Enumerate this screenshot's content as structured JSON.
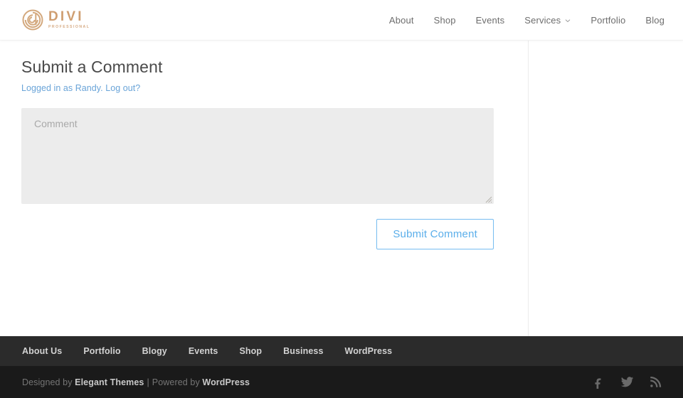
{
  "header": {
    "logo": {
      "name": "DIVI",
      "tagline": "PROFESSIONAL",
      "icon": "divi-spiral-logo-icon",
      "color": "#cf9e71"
    },
    "nav": [
      {
        "label": "About",
        "has_dropdown": false
      },
      {
        "label": "Shop",
        "has_dropdown": false
      },
      {
        "label": "Events",
        "has_dropdown": false
      },
      {
        "label": "Services",
        "has_dropdown": true,
        "caret_icon": "chevron-down-icon"
      },
      {
        "label": "Portfolio",
        "has_dropdown": false
      },
      {
        "label": "Blog",
        "has_dropdown": false
      }
    ]
  },
  "main": {
    "comment_form": {
      "title": "Submit a Comment",
      "logged_in_prefix": "Logged in as Randy.",
      "logout_label": "Log out?",
      "comment_placeholder": "Comment",
      "comment_value": "",
      "submit_label": "Submit Comment",
      "submit_color": "#5aaeea",
      "field_background": "#ececec",
      "resize_handle_icon": "resize-grip-icon"
    }
  },
  "footer": {
    "nav": [
      {
        "label": "About Us"
      },
      {
        "label": "Portfolio"
      },
      {
        "label": "Blogy"
      },
      {
        "label": "Events"
      },
      {
        "label": "Shop"
      },
      {
        "label": "Business"
      },
      {
        "label": "WordPress"
      }
    ],
    "credits": {
      "designed_by": "Designed by",
      "designer": "Elegant Themes",
      "separator": "|",
      "powered_by": "Powered by",
      "platform": "WordPress"
    },
    "social": [
      {
        "name": "facebook-icon",
        "label": "Facebook"
      },
      {
        "name": "twitter-icon",
        "label": "Twitter"
      },
      {
        "name": "rss-icon",
        "label": "RSS"
      }
    ]
  }
}
